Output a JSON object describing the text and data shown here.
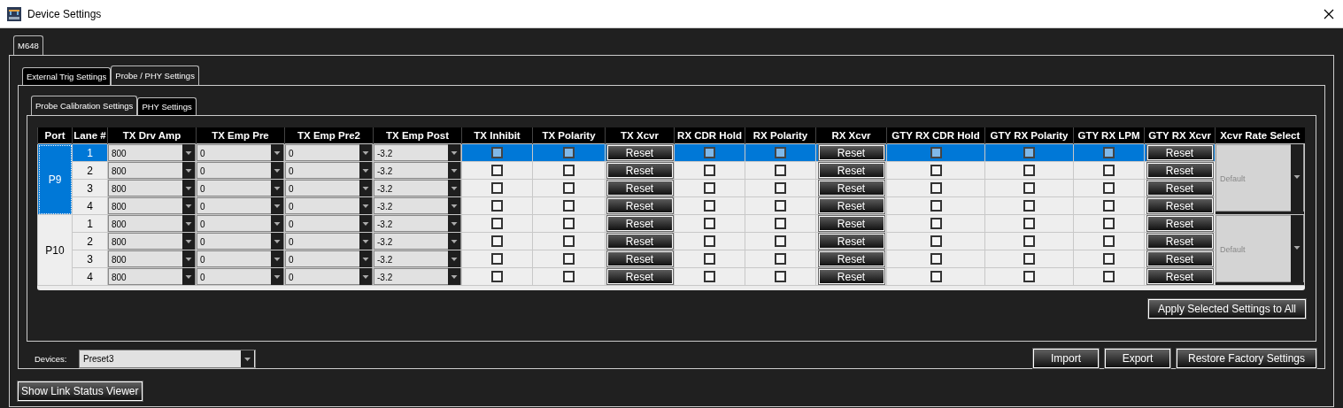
{
  "window": {
    "title": "Device Settings"
  },
  "device_tabs": [
    {
      "label": "M648",
      "selected": true
    }
  ],
  "settings_tabs": [
    {
      "label": "External Trig Settings",
      "selected": false
    },
    {
      "label": "Probe / PHY Settings",
      "selected": true
    }
  ],
  "sub_tabs": [
    {
      "label": "Probe Calibration Settings",
      "selected": true
    },
    {
      "label": "PHY Settings",
      "selected": false
    }
  ],
  "table": {
    "columns": [
      "Port",
      "Lane #",
      "TX Drv Amp",
      "TX Emp Pre",
      "TX Emp Pre2",
      "TX Emp Post",
      "TX Inhibit",
      "TX Polarity",
      "TX Xcvr",
      "RX CDR Hold",
      "RX Polarity",
      "RX Xcvr",
      "GTY RX CDR Hold",
      "GTY RX Polarity",
      "GTY RX LPM",
      "GTY RX Xcvr",
      "Xcvr Rate Select"
    ],
    "ports": [
      {
        "port": "P9",
        "selected": true,
        "rate": "Default",
        "lanes": [
          {
            "lane": "1",
            "selected": true,
            "drv_amp": "800",
            "emp_pre": "0",
            "emp_pre2": "0",
            "emp_post": "-3.2",
            "tx_inhibit": false,
            "tx_polarity": false,
            "tx_xcvr": "Reset",
            "rx_cdr_hold": false,
            "rx_polarity": false,
            "rx_xcvr": "Reset",
            "gty_cdr_hold": false,
            "gty_polarity": false,
            "gty_lpm": false,
            "gty_xcvr": "Reset"
          },
          {
            "lane": "2",
            "selected": false,
            "drv_amp": "800",
            "emp_pre": "0",
            "emp_pre2": "0",
            "emp_post": "-3.2",
            "tx_inhibit": false,
            "tx_polarity": false,
            "tx_xcvr": "Reset",
            "rx_cdr_hold": false,
            "rx_polarity": false,
            "rx_xcvr": "Reset",
            "gty_cdr_hold": false,
            "gty_polarity": false,
            "gty_lpm": false,
            "gty_xcvr": "Reset"
          },
          {
            "lane": "3",
            "selected": false,
            "drv_amp": "800",
            "emp_pre": "0",
            "emp_pre2": "0",
            "emp_post": "-3.2",
            "tx_inhibit": false,
            "tx_polarity": false,
            "tx_xcvr": "Reset",
            "rx_cdr_hold": false,
            "rx_polarity": false,
            "rx_xcvr": "Reset",
            "gty_cdr_hold": false,
            "gty_polarity": false,
            "gty_lpm": false,
            "gty_xcvr": "Reset"
          },
          {
            "lane": "4",
            "selected": false,
            "drv_amp": "800",
            "emp_pre": "0",
            "emp_pre2": "0",
            "emp_post": "-3.2",
            "tx_inhibit": false,
            "tx_polarity": false,
            "tx_xcvr": "Reset",
            "rx_cdr_hold": false,
            "rx_polarity": false,
            "rx_xcvr": "Reset",
            "gty_cdr_hold": false,
            "gty_polarity": false,
            "gty_lpm": false,
            "gty_xcvr": "Reset"
          }
        ]
      },
      {
        "port": "P10",
        "selected": false,
        "rate": "Default",
        "lanes": [
          {
            "lane": "1",
            "selected": false,
            "drv_amp": "800",
            "emp_pre": "0",
            "emp_pre2": "0",
            "emp_post": "-3.2",
            "tx_inhibit": false,
            "tx_polarity": false,
            "tx_xcvr": "Reset",
            "rx_cdr_hold": false,
            "rx_polarity": false,
            "rx_xcvr": "Reset",
            "gty_cdr_hold": false,
            "gty_polarity": false,
            "gty_lpm": false,
            "gty_xcvr": "Reset"
          },
          {
            "lane": "2",
            "selected": false,
            "drv_amp": "800",
            "emp_pre": "0",
            "emp_pre2": "0",
            "emp_post": "-3.2",
            "tx_inhibit": false,
            "tx_polarity": false,
            "tx_xcvr": "Reset",
            "rx_cdr_hold": false,
            "rx_polarity": false,
            "rx_xcvr": "Reset",
            "gty_cdr_hold": false,
            "gty_polarity": false,
            "gty_lpm": false,
            "gty_xcvr": "Reset"
          },
          {
            "lane": "3",
            "selected": false,
            "drv_amp": "800",
            "emp_pre": "0",
            "emp_pre2": "0",
            "emp_post": "-3.2",
            "tx_inhibit": false,
            "tx_polarity": false,
            "tx_xcvr": "Reset",
            "rx_cdr_hold": false,
            "rx_polarity": false,
            "rx_xcvr": "Reset",
            "gty_cdr_hold": false,
            "gty_polarity": false,
            "gty_lpm": false,
            "gty_xcvr": "Reset"
          },
          {
            "lane": "4",
            "selected": false,
            "drv_amp": "800",
            "emp_pre": "0",
            "emp_pre2": "0",
            "emp_post": "-3.2",
            "tx_inhibit": false,
            "tx_polarity": false,
            "tx_xcvr": "Reset",
            "rx_cdr_hold": false,
            "rx_polarity": false,
            "rx_xcvr": "Reset",
            "gty_cdr_hold": false,
            "gty_polarity": false,
            "gty_lpm": false,
            "gty_xcvr": "Reset"
          }
        ]
      }
    ]
  },
  "apply_button": "Apply Selected Settings to All",
  "devices": {
    "label": "Devices:",
    "value": "Preset3"
  },
  "actions": [
    "Import",
    "Export",
    "Restore Factory Settings"
  ],
  "link_status_button": "Show Link Status Viewer"
}
